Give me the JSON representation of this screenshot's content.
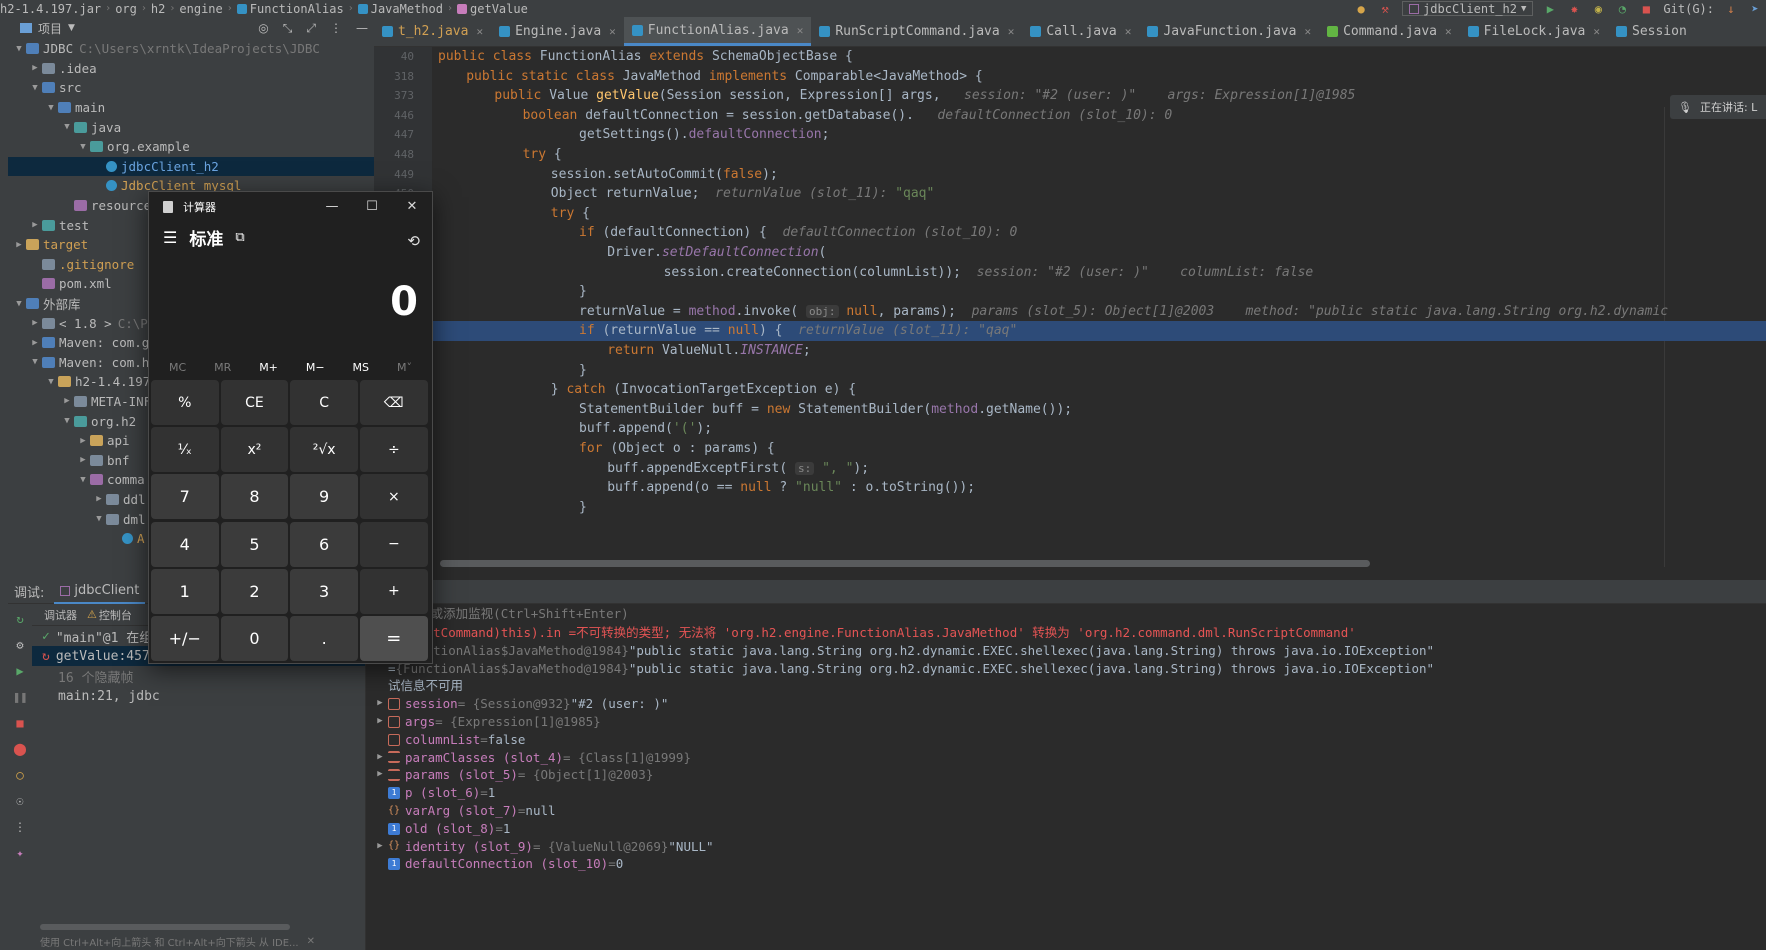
{
  "nav": {
    "crumbs": [
      "h2-1.4.197.jar",
      "org",
      "h2",
      "engine",
      "FunctionAlias",
      "JavaMethod",
      "getValue"
    ],
    "run_config": "jdbcClient_h2",
    "git_label": "Git(G):"
  },
  "project": {
    "header": "项目",
    "tree": [
      {
        "depth": 0,
        "arrow": "down",
        "icon": "module-folder",
        "name": "JDBC",
        "extra": "C:\\Users\\xrntk\\IdeaProjects\\JDBC"
      },
      {
        "depth": 1,
        "arrow": "right",
        "icon": "folder",
        "name": ".idea"
      },
      {
        "depth": 1,
        "arrow": "down",
        "icon": "folder-blue",
        "name": "src"
      },
      {
        "depth": 2,
        "arrow": "down",
        "icon": "folder-blue",
        "name": "main"
      },
      {
        "depth": 3,
        "arrow": "down",
        "icon": "folder-teal",
        "name": "java"
      },
      {
        "depth": 4,
        "arrow": "down",
        "icon": "package",
        "name": "org.example"
      },
      {
        "depth": 5,
        "arrow": "",
        "icon": "java-class",
        "name": "jdbcClient_h2",
        "selected": true
      },
      {
        "depth": 5,
        "arrow": "",
        "icon": "java-class",
        "name": "JdbcClient_mysql"
      },
      {
        "depth": 3,
        "arrow": "",
        "icon": "folder-pink",
        "name": "resources"
      },
      {
        "depth": 1,
        "arrow": "right",
        "icon": "folder-teal",
        "name": "test"
      },
      {
        "depth": 0,
        "arrow": "right",
        "icon": "folder-yellow",
        "name": "target",
        "orange": true
      },
      {
        "depth": 1,
        "arrow": "",
        "icon": "gitignore",
        "name": ".gitignore",
        "orange": true
      },
      {
        "depth": 1,
        "arrow": "",
        "icon": "maven",
        "name": "pom.xml"
      },
      {
        "depth": 0,
        "arrow": "down",
        "icon": "library",
        "name": "外部库"
      },
      {
        "depth": 1,
        "arrow": "right",
        "icon": "jdk",
        "name": "< 1.8 >",
        "extra": "C:\\P"
      },
      {
        "depth": 1,
        "arrow": "right",
        "icon": "library",
        "name": "Maven: com.g"
      },
      {
        "depth": 1,
        "arrow": "down",
        "icon": "library",
        "name": "Maven: com.h"
      },
      {
        "depth": 2,
        "arrow": "down",
        "icon": "jar",
        "name": "h2-1.4.197"
      },
      {
        "depth": 3,
        "arrow": "right",
        "icon": "folder",
        "name": "META-INF"
      },
      {
        "depth": 3,
        "arrow": "down",
        "icon": "package",
        "name": "org.h2"
      },
      {
        "depth": 4,
        "arrow": "right",
        "icon": "folder-yellow",
        "name": "api"
      },
      {
        "depth": 4,
        "arrow": "right",
        "icon": "folder",
        "name": "bnf"
      },
      {
        "depth": 4,
        "arrow": "down",
        "icon": "folder-pink",
        "name": "comma"
      },
      {
        "depth": 5,
        "arrow": "right",
        "icon": "folder",
        "name": "ddl"
      },
      {
        "depth": 5,
        "arrow": "down",
        "icon": "folder",
        "name": "dml"
      },
      {
        "depth": 6,
        "arrow": "",
        "icon": "java-class",
        "name": "A"
      }
    ]
  },
  "tabs": [
    {
      "label": "t_h2.java",
      "icon": "java",
      "active": false
    },
    {
      "label": "Engine.java",
      "icon": "java",
      "active": false
    },
    {
      "label": "FunctionAlias.java",
      "icon": "java",
      "active": true
    },
    {
      "label": "RunScriptCommand.java",
      "icon": "java",
      "active": false
    },
    {
      "label": "Call.java",
      "icon": "java",
      "active": false
    },
    {
      "label": "JavaFunction.java",
      "icon": "java",
      "active": false
    },
    {
      "label": "Command.java",
      "icon": "interface",
      "active": false
    },
    {
      "label": "FileLock.java",
      "icon": "java",
      "active": false
    },
    {
      "label": "Session",
      "icon": "java",
      "active": false
    }
  ],
  "editor": {
    "voice_status": "正在讲话: L",
    "lines": [
      {
        "n": "40",
        "indent": 0,
        "segs": [
          [
            "kw",
            "public class "
          ],
          [
            "",
            "FunctionAlias "
          ],
          [
            "kw",
            "extends "
          ],
          [
            "",
            "SchemaObjectBase {"
          ]
        ]
      },
      {
        "n": "318",
        "indent": 1,
        "segs": [
          [
            "kw",
            "public static class "
          ],
          [
            "",
            "JavaMethod "
          ],
          [
            "kw",
            "implements "
          ],
          [
            "",
            "Comparable<JavaMethod> {"
          ]
        ]
      },
      {
        "n": "373",
        "indent": 2,
        "segs": [
          [
            "kw",
            "public "
          ],
          [
            "",
            "Value "
          ],
          [
            "fn",
            "getValue"
          ],
          [
            "",
            "(Session session, Expression[] args,   "
          ],
          [
            "hint",
            "session: \"#2 (user: )\"    args: Expression[1]@1985"
          ]
        ]
      },
      {
        "n": "446",
        "indent": 3,
        "segs": [
          [
            "kw",
            "boolean "
          ],
          [
            "",
            "defaultConnection = session.getDatabase().   "
          ],
          [
            "hint",
            "defaultConnection (slot_10): 0"
          ]
        ]
      },
      {
        "n": "447",
        "indent": 5,
        "segs": [
          [
            "",
            "getSettings()."
          ],
          [
            "fld",
            "defaultConnection"
          ],
          [
            "",
            ";"
          ]
        ]
      },
      {
        "n": "448",
        "indent": 3,
        "segs": [
          [
            "kw",
            "try "
          ],
          [
            "",
            "{"
          ]
        ]
      },
      {
        "n": "449",
        "indent": 4,
        "segs": [
          [
            "",
            "session.setAutoCommit("
          ],
          [
            "kw",
            "false"
          ],
          [
            "",
            ");"
          ]
        ]
      },
      {
        "n": "450",
        "indent": 4,
        "segs": [
          [
            "",
            "Object returnValue;  "
          ],
          [
            "hint",
            "returnValue (slot_11): "
          ],
          [
            "str",
            "\"qaq\""
          ]
        ]
      },
      {
        "n": "451",
        "indent": 4,
        "segs": [
          [
            "kw",
            "try "
          ],
          [
            "",
            "{"
          ]
        ]
      },
      {
        "n": "452",
        "indent": 5,
        "segs": [
          [
            "kw",
            "if "
          ],
          [
            "",
            "(defaultConnection) {  "
          ],
          [
            "hint",
            "defaultConnection (slot_10): 0"
          ]
        ]
      },
      {
        "n": "453",
        "indent": 6,
        "segs": [
          [
            "",
            "Driver."
          ],
          [
            "stat",
            "setDefaultConnection"
          ],
          [
            "",
            "("
          ]
        ]
      },
      {
        "n": "454",
        "indent": 8,
        "segs": [
          [
            "",
            "session.createConnection(columnList));  "
          ],
          [
            "hint",
            "session: \"#2 (user: )\"    columnList: false"
          ]
        ]
      },
      {
        "n": "455",
        "indent": 5,
        "segs": [
          [
            "",
            "}"
          ]
        ]
      },
      {
        "n": "456",
        "indent": 5,
        "segs": [
          [
            "",
            "returnValue = "
          ],
          [
            "fld",
            "method"
          ],
          [
            "",
            ".invoke( "
          ],
          [
            "box",
            "obj:"
          ],
          [
            "kw",
            " null"
          ],
          [
            "",
            ", params);  "
          ],
          [
            "hint",
            "params (slot_5): Object[1]@2003    method: \"public static java.lang.String org.h2.dynamic"
          ]
        ]
      },
      {
        "n": "457",
        "indent": 5,
        "hl": true,
        "segs": [
          [
            "kw",
            "if "
          ],
          [
            "",
            "(returnValue == "
          ],
          [
            "kw",
            "null"
          ],
          [
            "",
            ") {  "
          ],
          [
            "hint",
            "returnValue (slot_11): \"qaq\""
          ]
        ]
      },
      {
        "n": "458",
        "indent": 6,
        "segs": [
          [
            "kw",
            "return "
          ],
          [
            "",
            "ValueNull."
          ],
          [
            "stat",
            "INSTANCE"
          ],
          [
            "",
            ";"
          ]
        ]
      },
      {
        "n": "459",
        "indent": 5,
        "segs": [
          [
            "",
            "}"
          ]
        ]
      },
      {
        "n": "460",
        "indent": 4,
        "segs": [
          [
            "",
            "} "
          ],
          [
            "kw",
            "catch "
          ],
          [
            "",
            "(InvocationTargetException e) {"
          ]
        ]
      },
      {
        "n": "461",
        "indent": 5,
        "segs": [
          [
            "",
            "StatementBuilder buff = "
          ],
          [
            "kw",
            "new "
          ],
          [
            "",
            "StatementBuilder("
          ],
          [
            "fld",
            "method"
          ],
          [
            "",
            ".getName());"
          ]
        ]
      },
      {
        "n": "462",
        "indent": 5,
        "segs": [
          [
            "",
            "buff.append("
          ],
          [
            "str",
            "'('"
          ],
          [
            "",
            ");"
          ]
        ]
      },
      {
        "n": "463",
        "indent": 5,
        "segs": [
          [
            "kw",
            "for "
          ],
          [
            "",
            "(Object o : params) {"
          ]
        ]
      },
      {
        "n": "464",
        "indent": 6,
        "segs": [
          [
            "",
            "buff.appendExceptFirst( "
          ],
          [
            "box",
            "s:"
          ],
          [
            "str",
            " \", \""
          ],
          [
            "",
            ");"
          ]
        ]
      },
      {
        "n": "465",
        "indent": 6,
        "segs": [
          [
            "",
            "buff.append(o == "
          ],
          [
            "kw",
            "null "
          ],
          [
            "",
            "? "
          ],
          [
            "str",
            "\"null\" "
          ],
          [
            "",
            ": o.toString());"
          ]
        ]
      },
      {
        "n": "466",
        "indent": 5,
        "segs": [
          [
            "",
            "}"
          ]
        ]
      }
    ]
  },
  "debug": {
    "title": "调试:",
    "session_tab": "jdbcClient",
    "frames_tabs": [
      "调试器",
      "控制台"
    ],
    "frames": [
      {
        "text": "\"main\"@1 在组",
        "type": "thread"
      },
      {
        "text": "getValue:457,",
        "type": "frame",
        "selected": true
      },
      {
        "text": "16 个隐藏帧",
        "type": "hidden"
      },
      {
        "text": "main:21, jdbc",
        "type": "frame"
      }
    ],
    "frames_hint": "使用 Ctrl+Alt+向上箭头 和 Ctrl+Alt+向下箭头 从 IDE...",
    "watch_placeholder": "(Enter)或添加监视(Ctrl+Shift+Enter)",
    "vars": [
      {
        "expand": false,
        "icon": "none",
        "name": "",
        "raw": "nScriptCommand)this).in = ",
        "value": "不可转换的类型; 无法将 'org.h2.engine.FunctionAlias.JavaMethod' 转换为 'org.h2.command.dml.RunScriptCommand'",
        "error": true
      },
      {
        "expand": false,
        "icon": "none",
        "name": "",
        "raw": "= ",
        "type": "{FunctionAlias$JavaMethod@1984} ",
        "value": "\"public static java.lang.String org.h2.dynamic.EXEC.shellexec(java.lang.String) throws java.io.IOException\""
      },
      {
        "expand": false,
        "icon": "none",
        "name": "",
        "raw": "= ",
        "type": "{FunctionAlias$JavaMethod@1984} ",
        "value": "\"public static java.lang.String org.h2.dynamic.EXEC.shellexec(java.lang.String) throws java.io.IOException\""
      },
      {
        "expand": false,
        "icon": "none",
        "name": "",
        "raw": "试信息不可用",
        "value": ""
      },
      {
        "expand": true,
        "icon": "obj",
        "name": "session",
        "type": " = {Session@932} ",
        "value": "\"#2 (user: )\""
      },
      {
        "expand": true,
        "icon": "obj",
        "name": "args",
        "type": " = {Expression[1]@1985}",
        "value": ""
      },
      {
        "expand": false,
        "icon": "obj",
        "name": "columnList",
        "type": " = ",
        "value": "false"
      },
      {
        "expand": true,
        "icon": "list",
        "name": "paramClasses (slot_4)",
        "type": " = {Class[1]@1999}",
        "value": ""
      },
      {
        "expand": true,
        "icon": "list",
        "name": "params (slot_5)",
        "type": " = {Object[1]@2003}",
        "value": ""
      },
      {
        "expand": false,
        "icon": "prim",
        "name": "p (slot_6)",
        "type": " = ",
        "value": "1"
      },
      {
        "expand": false,
        "icon": "brace",
        "name": "varArg (slot_7)",
        "type": " = ",
        "value": "null"
      },
      {
        "expand": false,
        "icon": "prim",
        "name": "old (slot_8)",
        "type": " = ",
        "value": "1"
      },
      {
        "expand": true,
        "icon": "brace",
        "name": "identity (slot_9)",
        "type": " = {ValueNull@2069} ",
        "value": "\"NULL\""
      },
      {
        "expand": false,
        "icon": "prim",
        "name": "defaultConnection (slot_10)",
        "type": " = ",
        "value": "0"
      }
    ]
  },
  "calculator": {
    "title": "计算器",
    "mode": "标准",
    "display": "0",
    "memory": [
      {
        "label": "MC",
        "enabled": false
      },
      {
        "label": "MR",
        "enabled": false
      },
      {
        "label": "M+",
        "enabled": true
      },
      {
        "label": "M−",
        "enabled": true
      },
      {
        "label": "MS",
        "enabled": true
      },
      {
        "label": "M˅",
        "enabled": false
      }
    ],
    "keys": [
      {
        "label": "%",
        "kind": "op",
        "name": "percent-key"
      },
      {
        "label": "CE",
        "kind": "op",
        "name": "clear-entry-key"
      },
      {
        "label": "C",
        "kind": "op",
        "name": "clear-key"
      },
      {
        "label": "⌫",
        "kind": "op",
        "name": "backspace-key"
      },
      {
        "label": "¹⁄ₓ",
        "kind": "op",
        "name": "reciprocal-key"
      },
      {
        "label": "x²",
        "kind": "op",
        "name": "square-key"
      },
      {
        "label": "²√x",
        "kind": "op",
        "name": "sqrt-key"
      },
      {
        "label": "÷",
        "kind": "op",
        "name": "divide-key"
      },
      {
        "label": "7",
        "kind": "num",
        "name": "digit-7-key"
      },
      {
        "label": "8",
        "kind": "num",
        "name": "digit-8-key"
      },
      {
        "label": "9",
        "kind": "num",
        "name": "digit-9-key"
      },
      {
        "label": "×",
        "kind": "op",
        "name": "multiply-key"
      },
      {
        "label": "4",
        "kind": "num",
        "name": "digit-4-key"
      },
      {
        "label": "5",
        "kind": "num",
        "name": "digit-5-key"
      },
      {
        "label": "6",
        "kind": "num",
        "name": "digit-6-key"
      },
      {
        "label": "−",
        "kind": "op",
        "name": "minus-key"
      },
      {
        "label": "1",
        "kind": "num",
        "name": "digit-1-key"
      },
      {
        "label": "2",
        "kind": "num",
        "name": "digit-2-key"
      },
      {
        "label": "3",
        "kind": "num",
        "name": "digit-3-key"
      },
      {
        "label": "+",
        "kind": "op",
        "name": "plus-key"
      },
      {
        "label": "+/−",
        "kind": "num",
        "name": "negate-key"
      },
      {
        "label": "0",
        "kind": "num",
        "name": "digit-0-key"
      },
      {
        "label": ".",
        "kind": "num",
        "name": "decimal-key"
      },
      {
        "label": "=",
        "kind": "eq",
        "name": "equals-key"
      }
    ]
  }
}
